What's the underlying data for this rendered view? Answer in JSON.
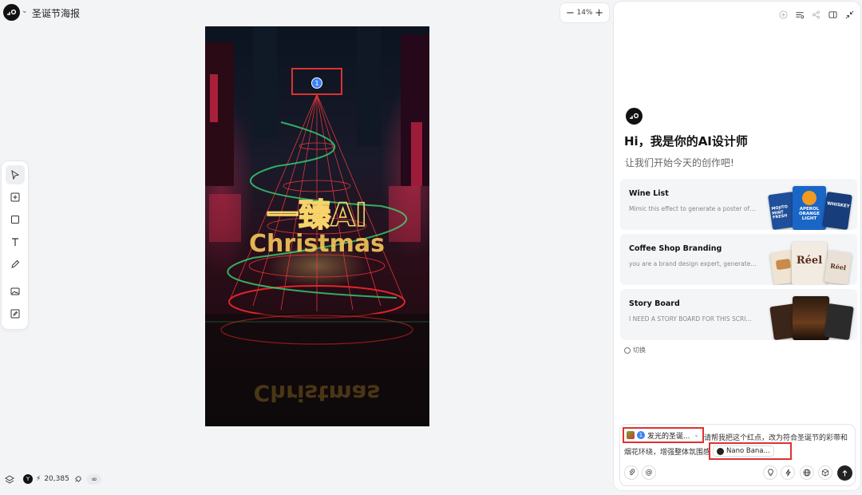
{
  "header": {
    "title": "圣诞节海报",
    "zoom": {
      "minus": "−",
      "value": "14%",
      "plus": "+"
    }
  },
  "canvas": {
    "poster_title_line1": "一臻AI",
    "poster_title_line2": "Christmas",
    "marker_number": "1"
  },
  "toolbar": {
    "tools": [
      "select-arrow-icon",
      "add-frame-icon",
      "rectangle-icon",
      "text-icon",
      "pen-icon",
      "image-add-icon",
      "image-edit-icon"
    ]
  },
  "footer": {
    "credits_badge": "Y",
    "credits": "20,385",
    "infinity": "∞"
  },
  "panel": {
    "greeting": "Hi，我是你的AI设计师",
    "subtitle": "让我们开始今天的创作吧!",
    "cards": [
      {
        "title": "Wine List",
        "desc": "Mimic this effect to generate a poster of ..."
      },
      {
        "title": "Coffee Shop Branding",
        "desc": "you are a brand design expert, generate ..."
      },
      {
        "title": "Story Board",
        "desc": "I NEED A STORY BOARD FOR THIS SCRI..."
      }
    ],
    "thumb_texts": {
      "aperol": "APEROL ORANGE LIGHT",
      "mojito": "MOJITO MINT FRESH",
      "whiskey": "WHISKEY",
      "reel": "Réel"
    },
    "switch_label": "切换",
    "input": {
      "chip_number": "1",
      "chip_label": "发光的圣诞...",
      "prompt_line1": "请帮我把这个红点，改为符合圣诞节的彩带和",
      "prompt_line2": "烟花环绕，增强整体氛围感",
      "model_label": "Nano Bana..."
    }
  }
}
